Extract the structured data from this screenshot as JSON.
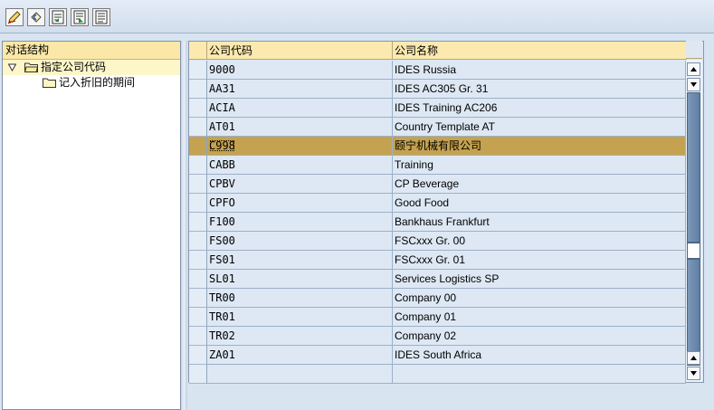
{
  "toolbar": {
    "buttons": [
      {
        "icon": "edit-pen-icon"
      },
      {
        "icon": "undo-icon"
      },
      {
        "icon": "previous-entry-icon"
      },
      {
        "icon": "next-entry-icon"
      },
      {
        "icon": "details-icon"
      }
    ]
  },
  "tree": {
    "header": "对话结构",
    "items": [
      {
        "label": "指定公司代码",
        "level": 0,
        "expanded": true,
        "selected": true
      },
      {
        "label": "记入折旧的期间",
        "level": 1,
        "expanded": false,
        "selected": false
      }
    ]
  },
  "table": {
    "columns": [
      "公司代码",
      "公司名称"
    ],
    "rows": [
      {
        "code": "9000",
        "name": "IDES Russia"
      },
      {
        "code": "AA31",
        "name": "IDES AC305 Gr. 31"
      },
      {
        "code": "ACIA",
        "name": "IDES Training AC206"
      },
      {
        "code": "AT01",
        "name": "Country Template AT"
      },
      {
        "code": "C998",
        "name": "颐宁机械有限公司",
        "highlighted": true
      },
      {
        "code": "CABB",
        "name": "Training"
      },
      {
        "code": "CPBV",
        "name": "CP Beverage"
      },
      {
        "code": "CPFO",
        "name": "Good Food"
      },
      {
        "code": "F100",
        "name": "Bankhaus Frankfurt"
      },
      {
        "code": "FS00",
        "name": "FSCxxx Gr. 00"
      },
      {
        "code": "FS01",
        "name": "FSCxxx Gr. 01"
      },
      {
        "code": "SL01",
        "name": "Services Logistics SP"
      },
      {
        "code": "TR00",
        "name": "Company 00"
      },
      {
        "code": "TR01",
        "name": "Company 01"
      },
      {
        "code": "TR02",
        "name": "Company 02"
      },
      {
        "code": "ZA01",
        "name": "IDES South Africa"
      },
      {
        "code": "",
        "name": ""
      }
    ]
  },
  "colors": {
    "highlight_row": "#c5a24f",
    "header_bg": "#fbe9b0",
    "cell_bg": "#dde8f4"
  }
}
